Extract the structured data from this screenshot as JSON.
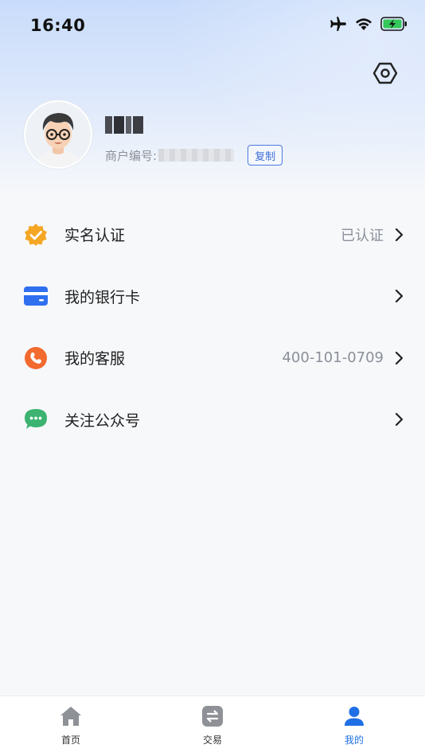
{
  "status_bar": {
    "time": "16:40",
    "icons": [
      "airplane-icon",
      "wifi-icon",
      "battery-charging-icon"
    ]
  },
  "header": {
    "settings_icon": "settings-hexagon-icon"
  },
  "profile": {
    "merchant_label": "商户编号:",
    "copy_label": "复制"
  },
  "menu": {
    "items": [
      {
        "label": "实名认证",
        "value": "已认证",
        "icon": "verified-badge-icon",
        "color": "#f5a623"
      },
      {
        "label": "我的银行卡",
        "value": "",
        "icon": "bank-card-icon",
        "color": "#2f6ff0"
      },
      {
        "label": "我的客服",
        "value": "400-101-0709",
        "icon": "phone-icon",
        "color": "#f26a2e"
      },
      {
        "label": "关注公众号",
        "value": "",
        "icon": "wechat-icon",
        "color": "#3cb371"
      }
    ]
  },
  "tab_bar": {
    "tabs": [
      {
        "label": "首页",
        "icon": "home-icon",
        "active": false
      },
      {
        "label": "交易",
        "icon": "transfer-icon",
        "active": false
      },
      {
        "label": "我的",
        "icon": "user-icon",
        "active": true
      }
    ],
    "active_color": "#1f6fe5",
    "inactive_color": "#8e9196"
  }
}
